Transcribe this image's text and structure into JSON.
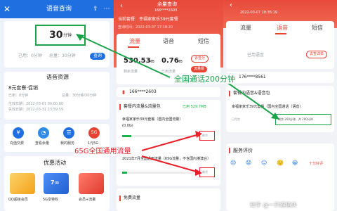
{
  "p1": {
    "title": "语音查询",
    "status_time": "",
    "minutes": "30",
    "minutes_unit": "分钟",
    "used": "已用：0分钟",
    "total": "总量：30分钟",
    "query_btn": "查询",
    "resources_title": "语音资源",
    "plan_name": "8元套餐-促销",
    "plan_rows": [
      "已用：0分钟",
      "总量：30分钟/30分钟"
    ],
    "dates": [
      "生效日期：2022-03-01 00:00:00",
      "失效日期：2022-03-31 23:59:59"
    ],
    "actions": [
      "充值交费",
      "查看余量",
      "我的服务",
      "1元5G"
    ],
    "offers_title": "优惠活动",
    "offers": [
      "QQ超级会员",
      "5G享特权",
      "会员+流量"
    ]
  },
  "p2": {
    "title": "余量查询",
    "phone": "166****2603",
    "plan": "当前套餐：幸福家家乐39元套餐",
    "query_time": "查询时间：2022-03-07 17:18:20",
    "tabs": [
      "流量",
      "语音",
      "短信"
    ],
    "remain_val": "530.53",
    "remain_unit": "MB",
    "used_val": "0.76",
    "used_unit": "MB",
    "remain_label": "剩余流量",
    "used_label": "已用流量",
    "btn1": "去查分",
    "btn2": "流量顺",
    "phone2": "166****2603",
    "section": "套餐内流量&流量包",
    "section_total": "已用 529.7MB",
    "item1": "幸福家家乐39元套餐（国内全国流量）",
    "item1_sub": "(0.0G)",
    "item2": "2021年7月全国通用流量（65G流量，不含国内港澳台）",
    "row_tag": "剩余",
    "free_section": "免费流量"
  },
  "p3": {
    "phone": "176****8561",
    "time": "2022-03-07 10:35:19",
    "tabs": [
      "流量",
      "语音",
      "短信"
    ],
    "used_label": "已用语音",
    "btn": "去查详单",
    "section": "套餐内语音&语音包",
    "plan": "幸福家家乐39元套餐（国内全国通话（语音）",
    "plan_sub": "(语音)",
    "row_detail": "剩余 200分钟，共 200分钟",
    "review_title": "服务评价",
    "review_right": "十分好评",
    "faces": [
      "😣",
      "😟",
      "😐",
      "🙂",
      "😀"
    ],
    "remark": "已用完"
  },
  "annotations": {
    "a1": "全国通话200分钟",
    "a2": "65G全国通用流量"
  },
  "watermark": "知乎 @一只猫猫侠",
  "colors": {
    "blue": "#1f6fe0",
    "red": "#e54434",
    "green": "#17b24a",
    "annotation": "#1aa34a",
    "annotation2": "#e8202a"
  }
}
